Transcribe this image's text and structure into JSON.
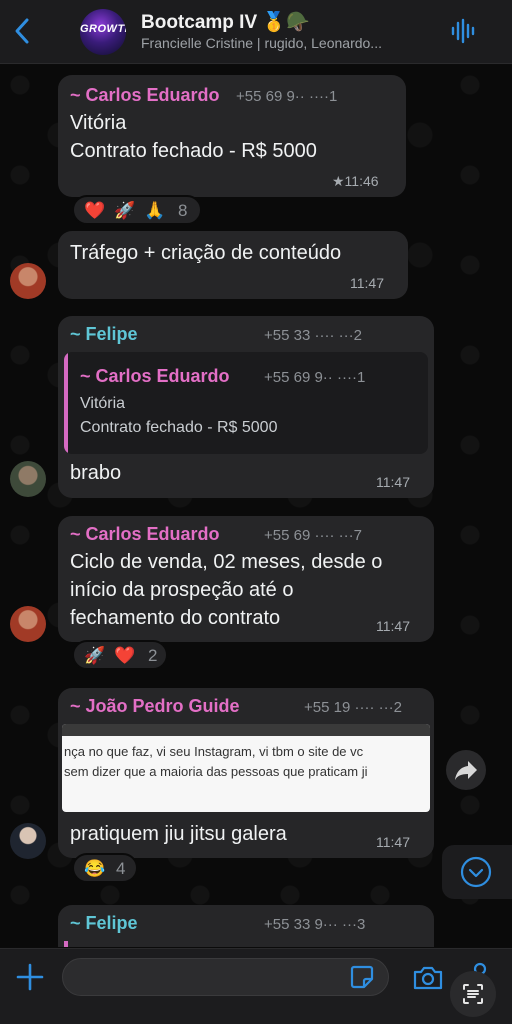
{
  "header": {
    "title": "Bootcamp IV 🥇🪖",
    "subtitle": "Francielle Cristine | rugido, Leonardo...",
    "group_avatar_text": "GROWTH"
  },
  "messages": [
    {
      "sender": "~ Carlos Eduardo",
      "phone": "+55 69 9·· ····1",
      "lines": [
        "Vitória",
        "Contrato fechado - R$ 5000"
      ],
      "time": "★11:46",
      "reactions": {
        "emojis": [
          "❤️",
          "🚀",
          "🙏"
        ],
        "count": "8"
      }
    },
    {
      "lines": [
        "Tráfego + criação de conteúdo"
      ],
      "time": "11:47"
    },
    {
      "sender": "~ Felipe",
      "phone": "+55 33 ···· ···2",
      "quote": {
        "sender": "~ Carlos Eduardo",
        "phone": "+55 69 9·· ····1",
        "lines": [
          "Vitória",
          "Contrato fechado - R$ 5000"
        ]
      },
      "lines": [
        "brabo"
      ],
      "time": "11:47"
    },
    {
      "sender": "~ Carlos Eduardo",
      "phone": "+55 69 ···· ···7",
      "lines": [
        "Ciclo de venda, 02 meses, desde o",
        "início da prospeção até o",
        "fechamento do contrato"
      ],
      "time": "11:47",
      "reactions": {
        "emojis": [
          "🚀",
          "❤️"
        ],
        "count": "2"
      }
    },
    {
      "sender": "~ João Pedro Guide",
      "phone": "+55 19 ···· ···2",
      "image_text": [
        "nça no que faz, vi seu Instagram, vi tbm o site de vc",
        "sem dizer que a maioria das pessoas que praticam ji"
      ],
      "lines": [
        "pratiquem jiu jitsu galera"
      ],
      "time": "11:47",
      "reactions": {
        "emojis": [
          "😂"
        ],
        "count": "4"
      }
    },
    {
      "sender": "~ Felipe",
      "phone": "+55 33 9··· ···3"
    }
  ],
  "colors": {
    "carlos": "#e36fc6",
    "felipe": "#5fc6d6",
    "joao": "#e36fc6",
    "accent": "#2f8ee0"
  },
  "icons": [
    "chevron-left-icon",
    "audio-wave-icon",
    "forward-icon",
    "chevron-down-icon",
    "plus-icon",
    "sticker-icon",
    "camera-icon",
    "mic-icon",
    "scan-icon"
  ]
}
